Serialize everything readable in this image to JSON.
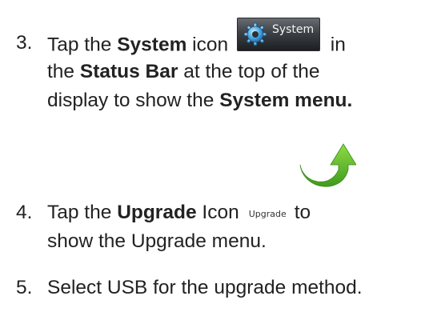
{
  "step3": {
    "number": "3.",
    "line1_a": "Tap the ",
    "line1_b": "System",
    "line1_c": " icon",
    "icon_label": "System",
    "line1_d": " in",
    "line2_a": "the ",
    "line2_b": "Status Bar",
    "line2_c": " at the top of the",
    "line3_a": "display to show the ",
    "line3_b": "System menu."
  },
  "step4": {
    "number": "4.",
    "line1_a": "Tap the ",
    "line1_b": "Upgrade",
    "line1_c": " Icon",
    "icon_label": "Upgrade",
    "line1_d": "to",
    "line2": "show the Upgrade menu."
  },
  "step5": {
    "number": "5.",
    "line1": "Select USB for the upgrade method."
  },
  "colors": {
    "text": "#222222",
    "arrow": "#5fbf2a",
    "icon_bg": "#3d4145"
  },
  "icons": {
    "system": "gear-icon",
    "arrow": "curved-arrow-icon",
    "upgrade": "upgrade-icon"
  }
}
